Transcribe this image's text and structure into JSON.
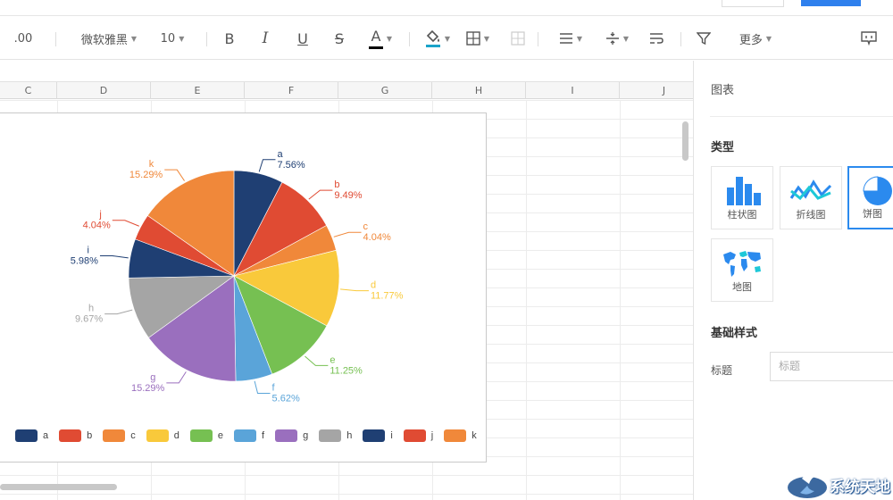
{
  "toolbar": {
    "decimal_label": ".00",
    "font_name": "微软雅黑",
    "font_size": "10",
    "bold": "B",
    "italic": "I",
    "underline": "U",
    "strike": "S",
    "font_color_letter": "A",
    "more_label": "更多",
    "colors": {
      "font_color": "#000000",
      "fill_color": "#1aa3c9"
    }
  },
  "columns": [
    "C",
    "D",
    "E",
    "F",
    "G",
    "H",
    "I",
    "J"
  ],
  "chart_data": {
    "type": "pie",
    "title": "",
    "slices": [
      {
        "label": "a",
        "value": 7.56,
        "pct": "7.56%",
        "color": "#1f3f73"
      },
      {
        "label": "b",
        "value": 9.49,
        "pct": "9.49%",
        "color": "#e04b33"
      },
      {
        "label": "c",
        "value": 4.04,
        "pct": "4.04%",
        "color": "#f0883a"
      },
      {
        "label": "d",
        "value": 11.77,
        "pct": "11.77%",
        "color": "#f9c93b"
      },
      {
        "label": "e",
        "value": 11.25,
        "pct": "11.25%",
        "color": "#76c052"
      },
      {
        "label": "f",
        "value": 5.62,
        "pct": "5.62%",
        "color": "#5aa4d9"
      },
      {
        "label": "g",
        "value": 15.29,
        "pct": "15.29%",
        "color": "#9a6fbe"
      },
      {
        "label": "h",
        "value": 9.67,
        "pct": "9.67%",
        "color": "#a5a5a5"
      },
      {
        "label": "i",
        "value": 5.98,
        "pct": "5.98%",
        "color": "#1f3f73"
      },
      {
        "label": "j",
        "value": 4.04,
        "pct": "4.04%",
        "color": "#e04b33"
      },
      {
        "label": "k",
        "value": 15.29,
        "pct": "15.29%",
        "color": "#f0883a"
      }
    ],
    "legend_position": "bottom"
  },
  "panel": {
    "title": "图表",
    "type_label": "类型",
    "chart_types": [
      {
        "label": "柱状图",
        "icon": "bar-chart-icon"
      },
      {
        "label": "折线图",
        "icon": "line-chart-icon"
      },
      {
        "label": "饼图",
        "icon": "pie-chart-icon",
        "selected": true
      },
      {
        "label": "地图",
        "icon": "world-map-icon"
      }
    ],
    "basic_style_label": "基础样式",
    "title_field_label": "标题",
    "title_placeholder": "标题",
    "accent_color": "#2b8aee"
  },
  "watermark": {
    "text": "系统天地"
  }
}
